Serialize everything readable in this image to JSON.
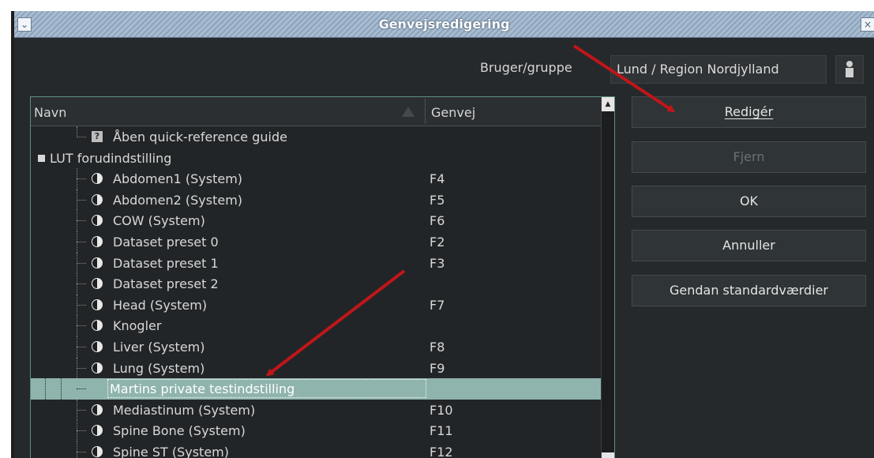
{
  "window": {
    "title": "Genvejsredigering"
  },
  "user": {
    "label": "Bruger/gruppe",
    "value": "Lund  / Region Nordjylland"
  },
  "tree": {
    "columns": {
      "name": "Navn",
      "shortcut": "Genvej"
    },
    "rows": [
      {
        "name": "Åben quick-reference guide",
        "shortcut": ""
      },
      {
        "name": "LUT forudindstilling",
        "shortcut": ""
      },
      {
        "name": "Abdomen1 (System)",
        "shortcut": "F4"
      },
      {
        "name": "Abdomen2 (System)",
        "shortcut": "F5"
      },
      {
        "name": "COW (System)",
        "shortcut": "F6"
      },
      {
        "name": "Dataset preset 0",
        "shortcut": "F2"
      },
      {
        "name": "Dataset preset 1",
        "shortcut": "F3"
      },
      {
        "name": "Dataset preset 2",
        "shortcut": ""
      },
      {
        "name": "Head (System)",
        "shortcut": "F7"
      },
      {
        "name": "Knogler",
        "shortcut": ""
      },
      {
        "name": "Liver (System)",
        "shortcut": "F8"
      },
      {
        "name": "Lung (System)",
        "shortcut": "F9"
      },
      {
        "name": "Martins private testindstilling",
        "shortcut": ""
      },
      {
        "name": "Mediastinum (System)",
        "shortcut": "F10"
      },
      {
        "name": "Spine Bone (System)",
        "shortcut": "F11"
      },
      {
        "name": "Spine ST (System)",
        "shortcut": "F12"
      }
    ]
  },
  "buttons": {
    "edit": "Redigér",
    "remove": "Fjern",
    "ok": "OK",
    "cancel": "Annuller",
    "restore": "Gendan standardværdier"
  },
  "colors": {
    "accent_selection": "#8fb4ad",
    "annotation_arrow": "#c0161a"
  },
  "icons": [
    "help-icon",
    "lut-preset-icon",
    "user-icon",
    "sort-icon",
    "expand-icon",
    "scroll-up-icon"
  ]
}
